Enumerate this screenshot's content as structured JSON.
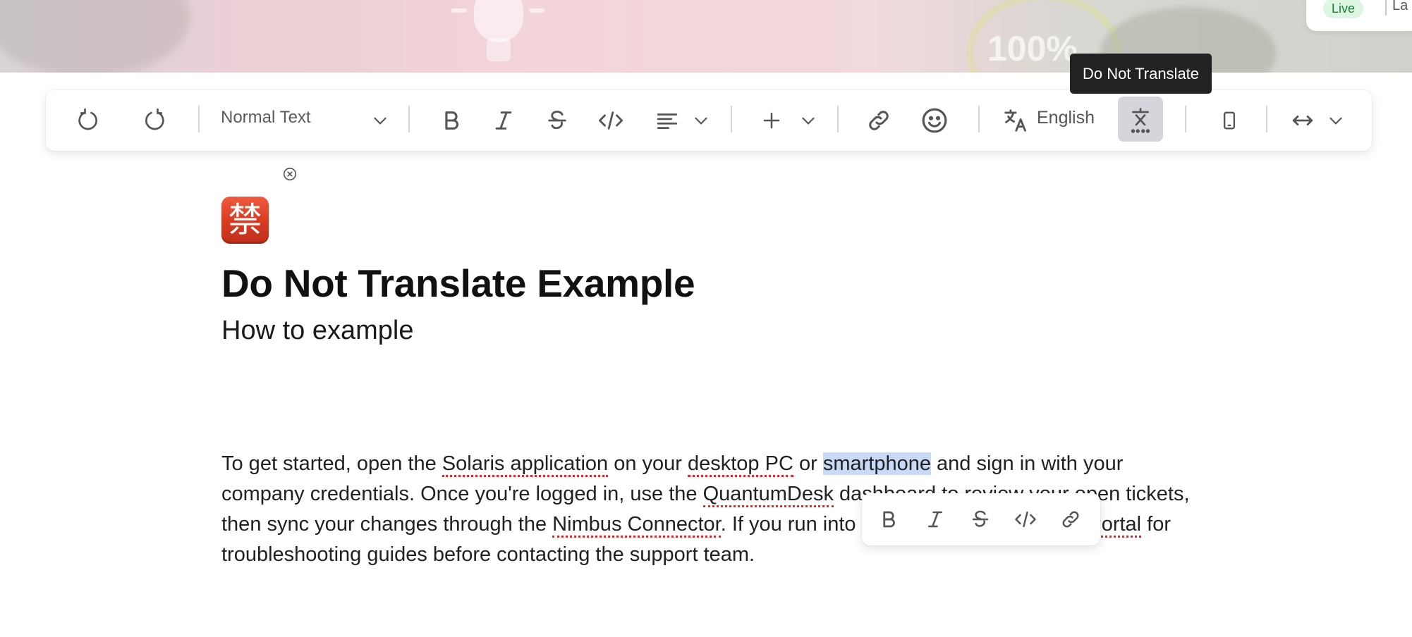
{
  "hero": {
    "stat_text": "100%",
    "live_badge": "Live",
    "more_text": "La"
  },
  "toolbar": {
    "undo_icon": "undo-icon",
    "redo_icon": "redo-icon",
    "text_style": "Normal Text",
    "language": "English",
    "tooltip": "Do Not Translate"
  },
  "content": {
    "emoji": "禁",
    "title": "Do Not Translate Example",
    "subtitle": "How to example",
    "paragraph": [
      {
        "text": "To get started, open the ",
        "type": "plain"
      },
      {
        "text": "Solaris application",
        "type": "dnt"
      },
      {
        "text": " on your ",
        "type": "plain"
      },
      {
        "text": "desktop PC",
        "type": "dnt"
      },
      {
        "text": " or ",
        "type": "plain"
      },
      {
        "text": "smartphone",
        "type": "selected"
      },
      {
        "text": " and sign in with your company credentials. Once you're logged in, use the ",
        "type": "plain"
      },
      {
        "text": "QuantumDesk",
        "type": "dnt"
      },
      {
        "text": " dashboard to review your open tickets, then sync your changes through the ",
        "type": "plain"
      },
      {
        "text": "Nimbus Connector",
        "type": "dnt"
      },
      {
        "text": ". If you run into issues, check the ",
        "type": "plain"
      },
      {
        "text": "Vertex Portal",
        "type": "dnt"
      },
      {
        "text": " for troubleshooting guides before contacting the support team.",
        "type": "plain"
      }
    ]
  },
  "colors": {
    "dnt_underline": "#d52b2b",
    "selection": "#c8daf5",
    "tooltip_bg": "#222222",
    "live_badge_bg": "#def7e3"
  }
}
